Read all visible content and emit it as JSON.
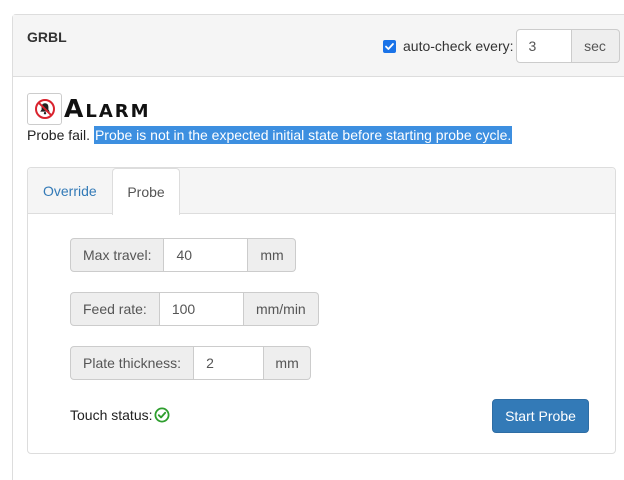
{
  "panel": {
    "title": "GRBL",
    "autocheck": {
      "checked": true,
      "label": "auto-check every:",
      "value": "3",
      "unit": "sec"
    }
  },
  "alarm": {
    "icon": "bell-slash-icon",
    "title": "Alarm",
    "message_prefix": "Probe fail.",
    "message_highlight": "Probe is not in the expected initial state before starting probe cycle."
  },
  "tabs": [
    {
      "label": "Override",
      "active": false
    },
    {
      "label": "Probe",
      "active": true
    }
  ],
  "probe": {
    "max_travel": {
      "label": "Max travel:",
      "value": "40",
      "unit": "mm"
    },
    "feed_rate": {
      "label": "Feed rate:",
      "value": "100",
      "unit": "mm/min"
    },
    "plate_thickness": {
      "label": "Plate thickness:",
      "value": "2",
      "unit": "mm"
    },
    "touch_status": {
      "label": "Touch status:",
      "icon": "check-circle-icon",
      "color": "#2e9e2e"
    },
    "start_button": "Start Probe"
  },
  "colors": {
    "accent": "#337ab7",
    "highlight": "#3d8fe0",
    "alarm_red": "#d9232e"
  }
}
